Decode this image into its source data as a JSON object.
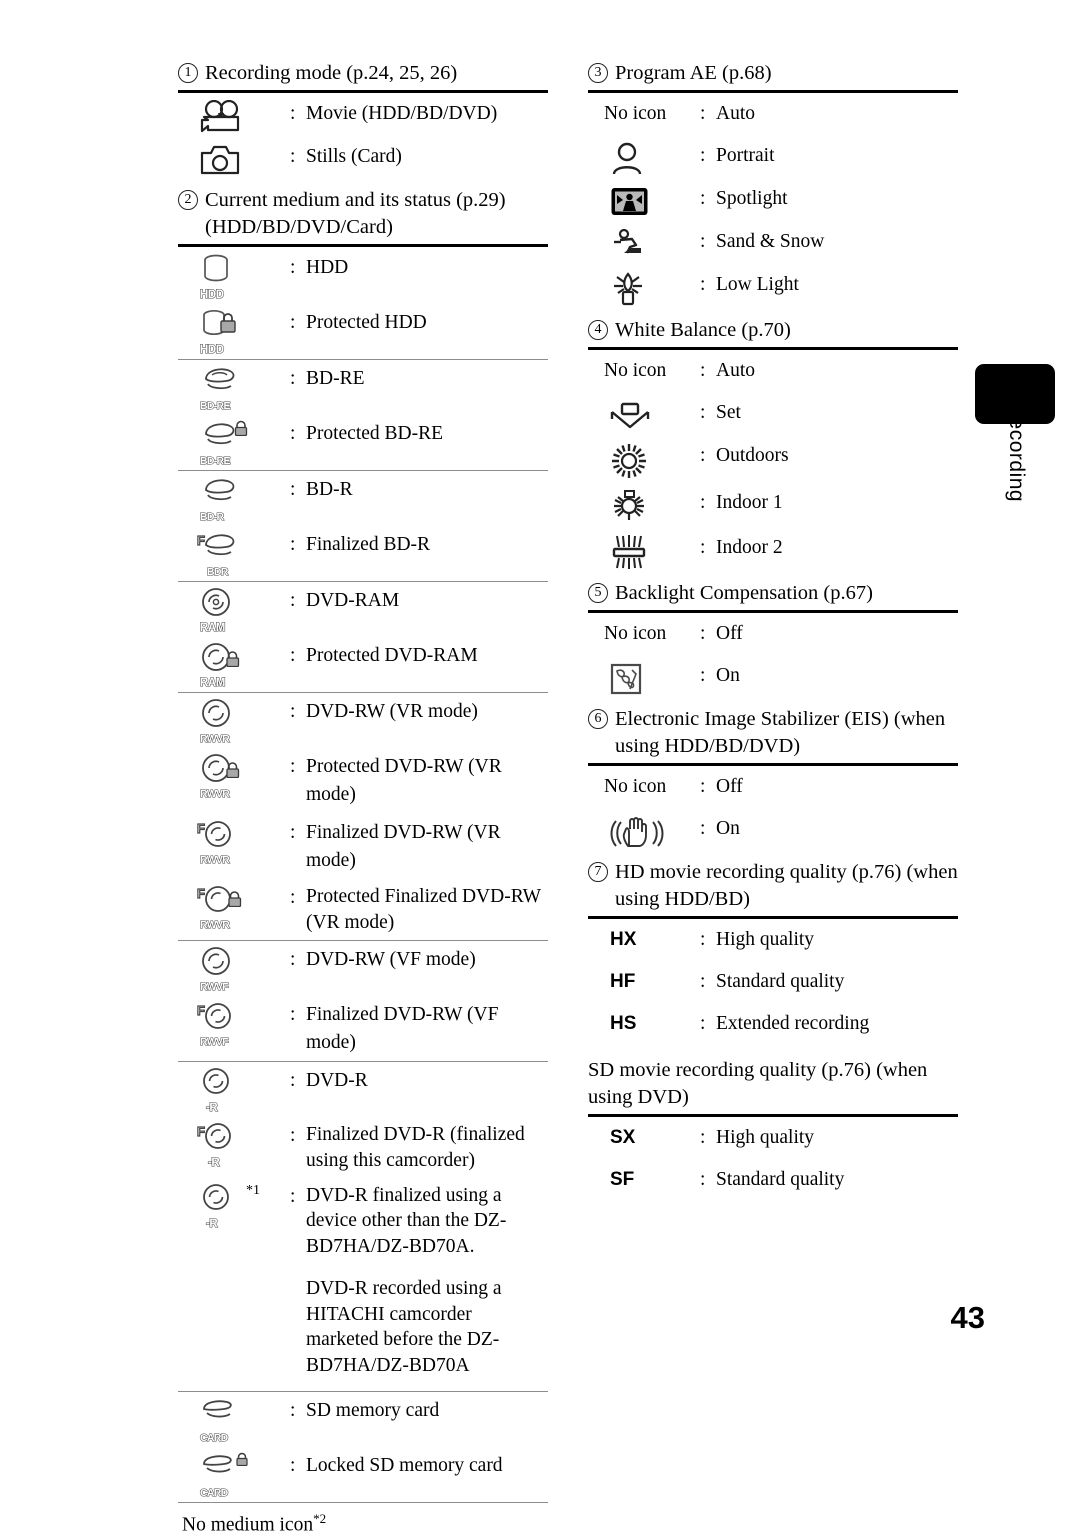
{
  "page": {
    "number": "43",
    "side_tab_label": "Recording"
  },
  "left_column": {
    "sections": [
      {
        "num": "1",
        "title": "Recording mode (p.24, 25, 26)",
        "rows": [
          {
            "icon": "movie-camera-icon",
            "colon": ":",
            "label": "Movie (HDD/BD/DVD)"
          },
          {
            "icon": "still-camera-icon",
            "colon": ":",
            "label": "Stills (Card)"
          }
        ]
      },
      {
        "num": "2",
        "title": "Current medium and its status (p.29) (HDD/BD/DVD/Card)",
        "groups": [
          {
            "rows": [
              {
                "icon": "hdd-icon",
                "badge": "HDD",
                "colon": ":",
                "label": "HDD"
              },
              {
                "icon": "hdd-locked-icon",
                "badge": "HDD",
                "colon": ":",
                "label": "Protected HDD"
              }
            ]
          },
          {
            "rows": [
              {
                "icon": "bd-disc-icon",
                "badge": "BD-RE",
                "colon": ":",
                "label": "BD-RE"
              },
              {
                "icon": "bd-disc-locked-icon",
                "badge": "BD-RE",
                "colon": ":",
                "label": "Protected BD-RE"
              }
            ]
          },
          {
            "rows": [
              {
                "icon": "bd-disc-icon",
                "badge": "BD-R",
                "colon": ":",
                "label": "BD-R"
              },
              {
                "icon": "bd-disc-finalized-icon",
                "badge": "BDR",
                "colon": ":",
                "label": "Finalized BD-R"
              }
            ]
          },
          {
            "rows": [
              {
                "icon": "dvd-disc-icon",
                "badge": "RAM",
                "colon": ":",
                "label": "DVD-RAM"
              },
              {
                "icon": "dvd-disc-locked-icon",
                "badge": "RAM",
                "colon": ":",
                "label": "Protected DVD-RAM"
              }
            ]
          },
          {
            "rows": [
              {
                "icon": "dvd-disc-icon",
                "badge": "RWVR",
                "colon": ":",
                "label": "DVD-RW (VR mode)"
              },
              {
                "icon": "dvd-disc-locked-icon",
                "badge": "RWVR",
                "colon": ":",
                "label": "Protected DVD-RW (VR mode)"
              },
              {
                "icon": "dvd-disc-finalized-icon",
                "badge": "RWVR",
                "colon": ":",
                "label": "Finalized DVD-RW (VR mode)"
              },
              {
                "icon": "dvd-disc-finalized-locked-icon",
                "badge": "RWVR",
                "colon": ":",
                "label": "Protected Finalized DVD-RW (VR mode)"
              }
            ]
          },
          {
            "rows": [
              {
                "icon": "dvd-disc-icon",
                "badge": "RWVF",
                "colon": ":",
                "label": "DVD-RW (VF mode)"
              },
              {
                "icon": "dvd-disc-finalized-icon",
                "badge": "RWVF",
                "colon": ":",
                "label": "Finalized DVD-RW (VF mode)"
              }
            ]
          },
          {
            "rows": [
              {
                "icon": "dvd-disc-icon",
                "badge": "-R",
                "colon": ":",
                "label": "DVD-R"
              },
              {
                "icon": "dvd-disc-finalized-icon",
                "badge": "-R",
                "colon": ":",
                "label": "Finalized DVD-R (finalized using this camcorder)"
              },
              {
                "icon": "dvd-disc-icon",
                "badge": "-R",
                "footnote": "*1",
                "colon": ":",
                "label": "DVD-R finalized using a device other than the DZ-BD7HA/DZ-BD70A.",
                "label2": "DVD-R recorded using a HITACHI camcorder marketed before the DZ-BD7HA/DZ-BD70A"
              }
            ]
          },
          {
            "rows": [
              {
                "icon": "sd-card-icon",
                "badge": "CARD",
                "colon": ":",
                "label": "SD memory card"
              },
              {
                "icon": "sd-card-locked-icon",
                "badge": "CARD",
                "colon": ":",
                "label": "Locked SD memory card"
              }
            ]
          }
        ],
        "footer": "No medium icon",
        "footer_footnote": "*2"
      }
    ]
  },
  "right_column": {
    "sections": [
      {
        "num": "3",
        "title": "Program AE (p.68)",
        "rows": [
          {
            "icon": "none",
            "no_icon_text": "No icon",
            "colon": ":",
            "label": "Auto"
          },
          {
            "icon": "portrait-icon",
            "colon": ":",
            "label": "Portrait"
          },
          {
            "icon": "spotlight-icon",
            "colon": ":",
            "label": "Spotlight"
          },
          {
            "icon": "sand-snow-icon",
            "colon": ":",
            "label": "Sand & Snow"
          },
          {
            "icon": "low-light-icon",
            "colon": ":",
            "label": "Low Light"
          }
        ]
      },
      {
        "num": "4",
        "title": "White Balance (p.70)",
        "rows": [
          {
            "icon": "none",
            "no_icon_text": "No icon",
            "colon": ":",
            "label": "Auto"
          },
          {
            "icon": "wb-set-icon",
            "colon": ":",
            "label": "Set"
          },
          {
            "icon": "outdoors-sun-icon",
            "colon": ":",
            "label": "Outdoors"
          },
          {
            "icon": "indoor1-bulb-icon",
            "colon": ":",
            "label": "Indoor 1"
          },
          {
            "icon": "indoor2-fluorescent-icon",
            "colon": ":",
            "label": "Indoor 2"
          }
        ]
      },
      {
        "num": "5",
        "title": "Backlight Compensation (p.67)",
        "rows": [
          {
            "icon": "none",
            "no_icon_text": "No icon",
            "colon": ":",
            "label": "Off"
          },
          {
            "icon": "backlight-icon",
            "colon": ":",
            "label": "On"
          }
        ]
      },
      {
        "num": "6",
        "title": "Electronic Image Stabilizer (EIS) (when using HDD/BD/DVD)",
        "rows": [
          {
            "icon": "none",
            "no_icon_text": "No icon",
            "colon": ":",
            "label": "Off"
          },
          {
            "icon": "eis-hand-icon",
            "colon": ":",
            "label": "On"
          }
        ]
      },
      {
        "num": "7",
        "title": "HD movie recording quality (p.76) (when using HDD/BD)",
        "rows": [
          {
            "code": "HX",
            "colon": ":",
            "label": "High quality"
          },
          {
            "code": "HF",
            "colon": ":",
            "label": "Standard quality"
          },
          {
            "code": "HS",
            "colon": ":",
            "label": "Extended recording"
          }
        ]
      },
      {
        "plain_title": "SD movie recording quality (p.76) (when using DVD)",
        "rows": [
          {
            "code": "SX",
            "colon": ":",
            "label": "High quality"
          },
          {
            "code": "SF",
            "colon": ":",
            "label": "Standard quality"
          }
        ]
      }
    ]
  }
}
